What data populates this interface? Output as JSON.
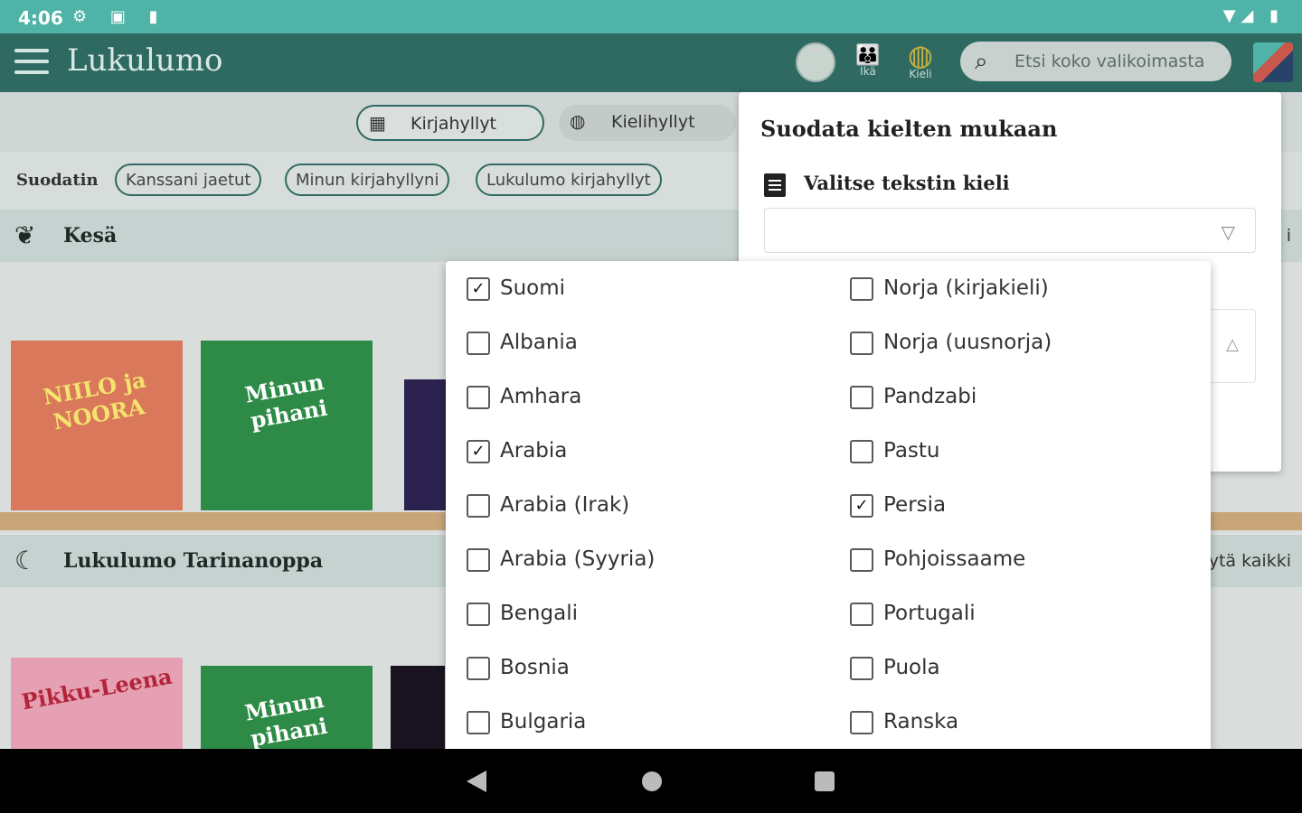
{
  "status_bar": {
    "time": "4:06",
    "left_icons": "⚙ ▣ ▮",
    "right_icons": "▼◢ ▮"
  },
  "app_bar": {
    "app_name": "Lukulumo",
    "age_label": "Ikä",
    "language_label": "Kieli",
    "search_placeholder": "Etsi koko valikoimasta"
  },
  "tabs": [
    {
      "label": "Kirjahyllyt",
      "icon": "grid-icon",
      "glyph": "▦"
    },
    {
      "label": "Kielihyllyt",
      "icon": "globe-icon",
      "glyph": "◍"
    }
  ],
  "filter": {
    "label": "Suodatin",
    "chips": [
      "Kanssani jaetut",
      "Minun kirjahyllyni",
      "Lukulumo kirjahyllyt"
    ]
  },
  "sections": [
    {
      "title": "Kesä",
      "icon": "leaf-icon",
      "glyph": "❦",
      "right": "i"
    },
    {
      "title": "Lukulumo Tarinanoppa",
      "icon": "moon-icon",
      "glyph": "☾",
      "right": "ytä kaikki"
    }
  ],
  "books_row1": [
    {
      "title": "NIILO ja NOORA",
      "bg": "#d9785a",
      "color": "#f4e36e"
    },
    {
      "title": "Minun pihani",
      "bg": "#2e8b47",
      "color": "#ffffff"
    }
  ],
  "books_row2": [
    {
      "title": "Pikku-Leena",
      "bg": "#e6a0b3",
      "color": "#b3243a"
    },
    {
      "title": "Minun pihani",
      "bg": "#2e8b47",
      "color": "#ffffff"
    }
  ],
  "language_panel": {
    "title": "Suodata kielten mukaan",
    "subtitle": "Valitse tekstin kieli",
    "caret_down": "▽",
    "caret_up": "△"
  },
  "language_options": {
    "left": [
      {
        "label": "Suomi",
        "checked": true
      },
      {
        "label": "Albania",
        "checked": false
      },
      {
        "label": "Amhara",
        "checked": false
      },
      {
        "label": "Arabia",
        "checked": true
      },
      {
        "label": "Arabia (Irak)",
        "checked": false
      },
      {
        "label": "Arabia (Syyria)",
        "checked": false
      },
      {
        "label": "Bengali",
        "checked": false
      },
      {
        "label": "Bosnia",
        "checked": false
      },
      {
        "label": "Bulgaria",
        "checked": false
      }
    ],
    "right": [
      {
        "label": "Norja (kirjakieli)",
        "checked": false
      },
      {
        "label": "Norja (uusnorja)",
        "checked": false
      },
      {
        "label": "Pandzabi",
        "checked": false
      },
      {
        "label": "Pastu",
        "checked": false
      },
      {
        "label": "Persia",
        "checked": true
      },
      {
        "label": "Pohjoissaame",
        "checked": false
      },
      {
        "label": "Portugali",
        "checked": false
      },
      {
        "label": "Puola",
        "checked": false
      },
      {
        "label": "Ranska",
        "checked": false
      }
    ]
  },
  "colors": {
    "accent": "#2f6a62",
    "status_bar": "#4fb3a7",
    "globe": "#c9b340"
  }
}
